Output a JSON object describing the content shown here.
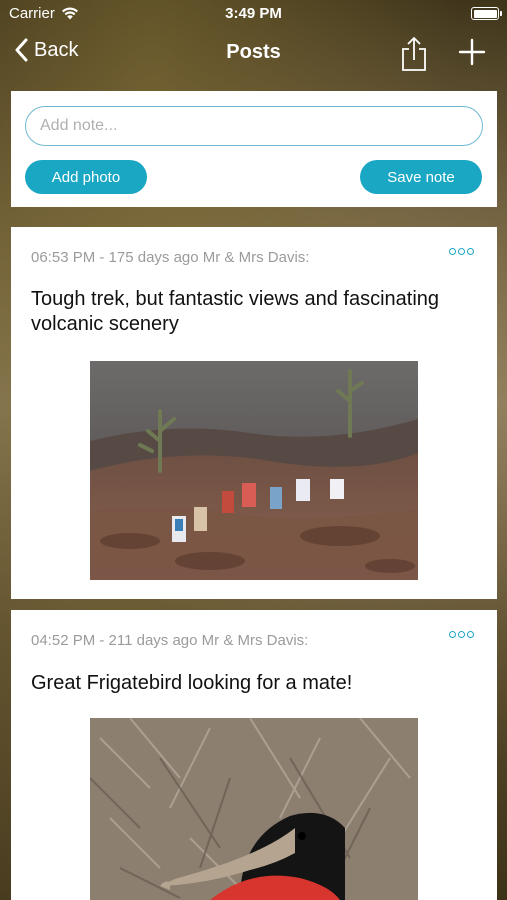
{
  "status_bar": {
    "carrier": "Carrier",
    "time": "3:49 PM",
    "battery_level": 1.0
  },
  "nav": {
    "back_label": "Back",
    "title": "Posts"
  },
  "composer": {
    "note_placeholder": "Add note...",
    "add_photo_label": "Add photo",
    "save_note_label": "Save note"
  },
  "posts": [
    {
      "meta": "06:53 PM - 175 days ago Mr & Mrs Davis:",
      "text": "Tough trek, but fantastic views and fascinating volcanic scenery",
      "photo_subject": "hikers-on-volcanic-lava-field"
    },
    {
      "meta": "04:52 PM - 211 days ago Mr & Mrs Davis:",
      "text": "Great Frigatebird looking for a mate!",
      "photo_subject": "great-frigatebird-in-dry-brush"
    }
  ],
  "colors": {
    "accent": "#1aa7c4",
    "input_border": "#6fb9d3",
    "meta_text": "#9b9b9b"
  },
  "icons": [
    "wifi-icon",
    "battery-icon",
    "chevron-left-icon",
    "share-icon",
    "plus-icon",
    "more-dots-icon"
  ]
}
